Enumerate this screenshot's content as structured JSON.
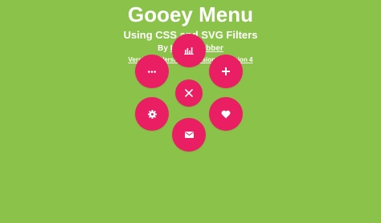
{
  "page": {
    "title": "Gooey Menu",
    "subtitle": "Using CSS and SVG Filters",
    "byline_prefix": "By",
    "author": "Lucas Bebber",
    "versions": [
      "Version 1",
      "Version 2",
      "Version 3",
      "Version 4"
    ]
  },
  "menu": {
    "toggle": {
      "icon": "close-icon"
    },
    "items": [
      {
        "icon": "chart-icon"
      },
      {
        "icon": "plus-icon"
      },
      {
        "icon": "heart-icon"
      },
      {
        "icon": "envelope-icon"
      },
      {
        "icon": "gear-icon"
      },
      {
        "icon": "ellipsis-icon"
      }
    ]
  },
  "colors": {
    "background": "#8bc34a",
    "accent": "#e91e63",
    "text": "#ffffff"
  }
}
